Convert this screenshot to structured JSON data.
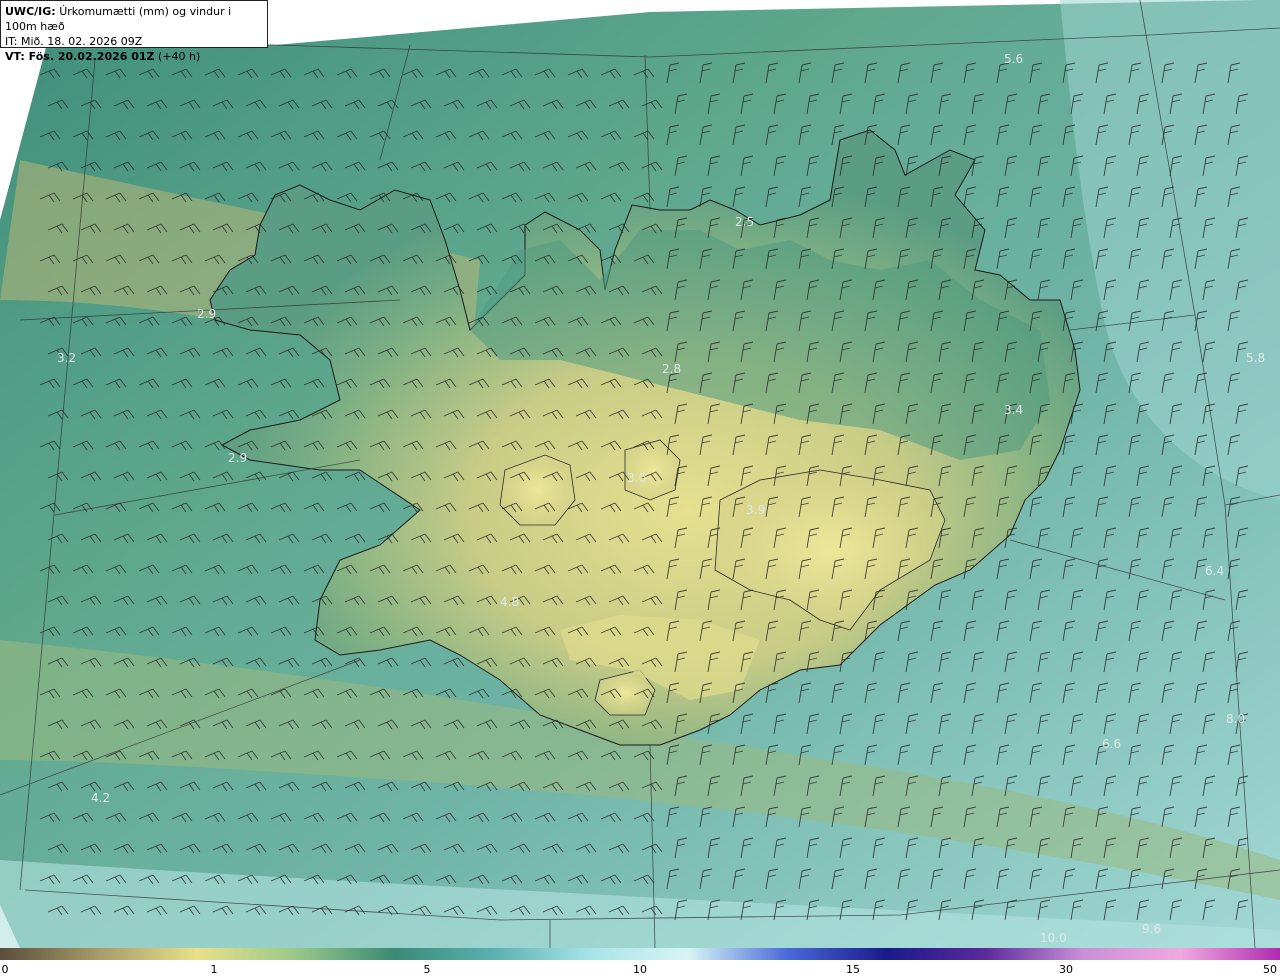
{
  "header": {
    "model": "UWC/IG:",
    "description": "Úrkomumætti (mm) og vindur i 100m hæð",
    "init_time": "IT: Mið. 18. 02. 2026 09Z",
    "valid_prefix": "VT: Fös. 20.02.2026 01Z",
    "valid_suffix": "(+40 h)"
  },
  "map_labels": [
    "5.6",
    "2.5",
    "2.9",
    "3.2",
    "2.8",
    "5.8",
    "3.4",
    "2.9",
    "3.0",
    "3.9",
    "4.8",
    "6.4",
    "4.2",
    "8.0",
    "6.6",
    "10.0",
    "9.6"
  ],
  "colorbar": {
    "ticks": [
      "0",
      "1",
      "5",
      "10",
      "15",
      "30",
      "50"
    ],
    "colors": [
      "#5a4e3c",
      "#a89a6a",
      "#e8e08a",
      "#9ac88a",
      "#3a8a74",
      "#5ab0b0",
      "#a8e4e8",
      "#d8f4f4",
      "#4a6ad8",
      "#1a1a8a",
      "#5a2a9a",
      "#c890d8",
      "#f0a8e0",
      "#b02ab0"
    ]
  },
  "colors": {
    "sea_dark": "#3a8a78",
    "sea_light": "#a8dcd8",
    "land_high": "#e6e090",
    "land_mid": "#6aa882",
    "coast": "#1a1a1a",
    "grid": "#333333"
  }
}
